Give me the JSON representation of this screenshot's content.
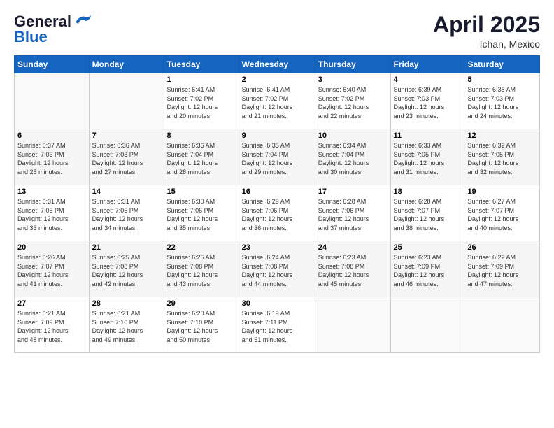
{
  "header": {
    "logo_general": "General",
    "logo_blue": "Blue",
    "month_title": "April 2025",
    "location": "Ichan, Mexico"
  },
  "calendar": {
    "days_of_week": [
      "Sunday",
      "Monday",
      "Tuesday",
      "Wednesday",
      "Thursday",
      "Friday",
      "Saturday"
    ],
    "weeks": [
      [
        {
          "day": "",
          "info": ""
        },
        {
          "day": "",
          "info": ""
        },
        {
          "day": "1",
          "info": "Sunrise: 6:41 AM\nSunset: 7:02 PM\nDaylight: 12 hours\nand 20 minutes."
        },
        {
          "day": "2",
          "info": "Sunrise: 6:41 AM\nSunset: 7:02 PM\nDaylight: 12 hours\nand 21 minutes."
        },
        {
          "day": "3",
          "info": "Sunrise: 6:40 AM\nSunset: 7:02 PM\nDaylight: 12 hours\nand 22 minutes."
        },
        {
          "day": "4",
          "info": "Sunrise: 6:39 AM\nSunset: 7:03 PM\nDaylight: 12 hours\nand 23 minutes."
        },
        {
          "day": "5",
          "info": "Sunrise: 6:38 AM\nSunset: 7:03 PM\nDaylight: 12 hours\nand 24 minutes."
        }
      ],
      [
        {
          "day": "6",
          "info": "Sunrise: 6:37 AM\nSunset: 7:03 PM\nDaylight: 12 hours\nand 25 minutes."
        },
        {
          "day": "7",
          "info": "Sunrise: 6:36 AM\nSunset: 7:03 PM\nDaylight: 12 hours\nand 27 minutes."
        },
        {
          "day": "8",
          "info": "Sunrise: 6:36 AM\nSunset: 7:04 PM\nDaylight: 12 hours\nand 28 minutes."
        },
        {
          "day": "9",
          "info": "Sunrise: 6:35 AM\nSunset: 7:04 PM\nDaylight: 12 hours\nand 29 minutes."
        },
        {
          "day": "10",
          "info": "Sunrise: 6:34 AM\nSunset: 7:04 PM\nDaylight: 12 hours\nand 30 minutes."
        },
        {
          "day": "11",
          "info": "Sunrise: 6:33 AM\nSunset: 7:05 PM\nDaylight: 12 hours\nand 31 minutes."
        },
        {
          "day": "12",
          "info": "Sunrise: 6:32 AM\nSunset: 7:05 PM\nDaylight: 12 hours\nand 32 minutes."
        }
      ],
      [
        {
          "day": "13",
          "info": "Sunrise: 6:31 AM\nSunset: 7:05 PM\nDaylight: 12 hours\nand 33 minutes."
        },
        {
          "day": "14",
          "info": "Sunrise: 6:31 AM\nSunset: 7:05 PM\nDaylight: 12 hours\nand 34 minutes."
        },
        {
          "day": "15",
          "info": "Sunrise: 6:30 AM\nSunset: 7:06 PM\nDaylight: 12 hours\nand 35 minutes."
        },
        {
          "day": "16",
          "info": "Sunrise: 6:29 AM\nSunset: 7:06 PM\nDaylight: 12 hours\nand 36 minutes."
        },
        {
          "day": "17",
          "info": "Sunrise: 6:28 AM\nSunset: 7:06 PM\nDaylight: 12 hours\nand 37 minutes."
        },
        {
          "day": "18",
          "info": "Sunrise: 6:28 AM\nSunset: 7:07 PM\nDaylight: 12 hours\nand 38 minutes."
        },
        {
          "day": "19",
          "info": "Sunrise: 6:27 AM\nSunset: 7:07 PM\nDaylight: 12 hours\nand 40 minutes."
        }
      ],
      [
        {
          "day": "20",
          "info": "Sunrise: 6:26 AM\nSunset: 7:07 PM\nDaylight: 12 hours\nand 41 minutes."
        },
        {
          "day": "21",
          "info": "Sunrise: 6:25 AM\nSunset: 7:08 PM\nDaylight: 12 hours\nand 42 minutes."
        },
        {
          "day": "22",
          "info": "Sunrise: 6:25 AM\nSunset: 7:08 PM\nDaylight: 12 hours\nand 43 minutes."
        },
        {
          "day": "23",
          "info": "Sunrise: 6:24 AM\nSunset: 7:08 PM\nDaylight: 12 hours\nand 44 minutes."
        },
        {
          "day": "24",
          "info": "Sunrise: 6:23 AM\nSunset: 7:08 PM\nDaylight: 12 hours\nand 45 minutes."
        },
        {
          "day": "25",
          "info": "Sunrise: 6:23 AM\nSunset: 7:09 PM\nDaylight: 12 hours\nand 46 minutes."
        },
        {
          "day": "26",
          "info": "Sunrise: 6:22 AM\nSunset: 7:09 PM\nDaylight: 12 hours\nand 47 minutes."
        }
      ],
      [
        {
          "day": "27",
          "info": "Sunrise: 6:21 AM\nSunset: 7:09 PM\nDaylight: 12 hours\nand 48 minutes."
        },
        {
          "day": "28",
          "info": "Sunrise: 6:21 AM\nSunset: 7:10 PM\nDaylight: 12 hours\nand 49 minutes."
        },
        {
          "day": "29",
          "info": "Sunrise: 6:20 AM\nSunset: 7:10 PM\nDaylight: 12 hours\nand 50 minutes."
        },
        {
          "day": "30",
          "info": "Sunrise: 6:19 AM\nSunset: 7:11 PM\nDaylight: 12 hours\nand 51 minutes."
        },
        {
          "day": "",
          "info": ""
        },
        {
          "day": "",
          "info": ""
        },
        {
          "day": "",
          "info": ""
        }
      ]
    ]
  }
}
